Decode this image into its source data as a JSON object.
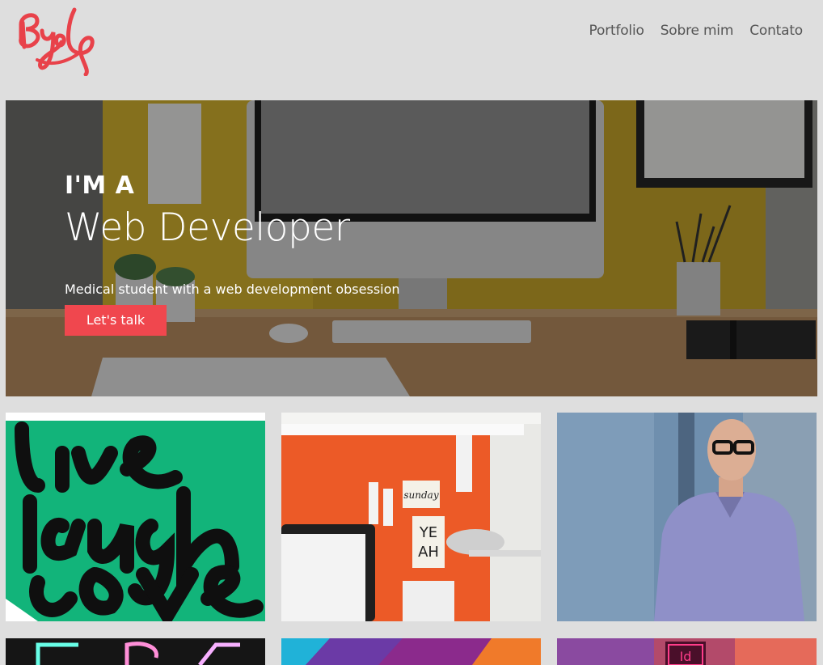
{
  "brand": {
    "logo_text": "Byol",
    "logo_color": "#e8424a"
  },
  "nav": {
    "items": [
      {
        "label": "Portfolio"
      },
      {
        "label": "Sobre mim"
      },
      {
        "label": "Contato"
      }
    ]
  },
  "hero": {
    "kicker": "I'M A",
    "headline": "Web Developer",
    "subline": "Medical student with a web development obsession",
    "cta_label": "Let's talk",
    "cta_color": "#f0474e"
  },
  "portfolio": {
    "tiles": [
      {
        "name": "live-laugh-love",
        "lettering": "live laugh love",
        "bg": "#12b47a"
      },
      {
        "name": "orange-desk",
        "note1": "sunday",
        "note2": "YE AH",
        "bg": "#ec5a27"
      },
      {
        "name": "man-portrait",
        "bg": "#6f8fae"
      },
      {
        "name": "neon-sign",
        "bg": "#151515"
      },
      {
        "name": "gradient-colors",
        "bg": "#8b2a8c"
      },
      {
        "name": "indesign-icon",
        "lettering": "Id",
        "bg": "#b34a6a"
      }
    ]
  }
}
